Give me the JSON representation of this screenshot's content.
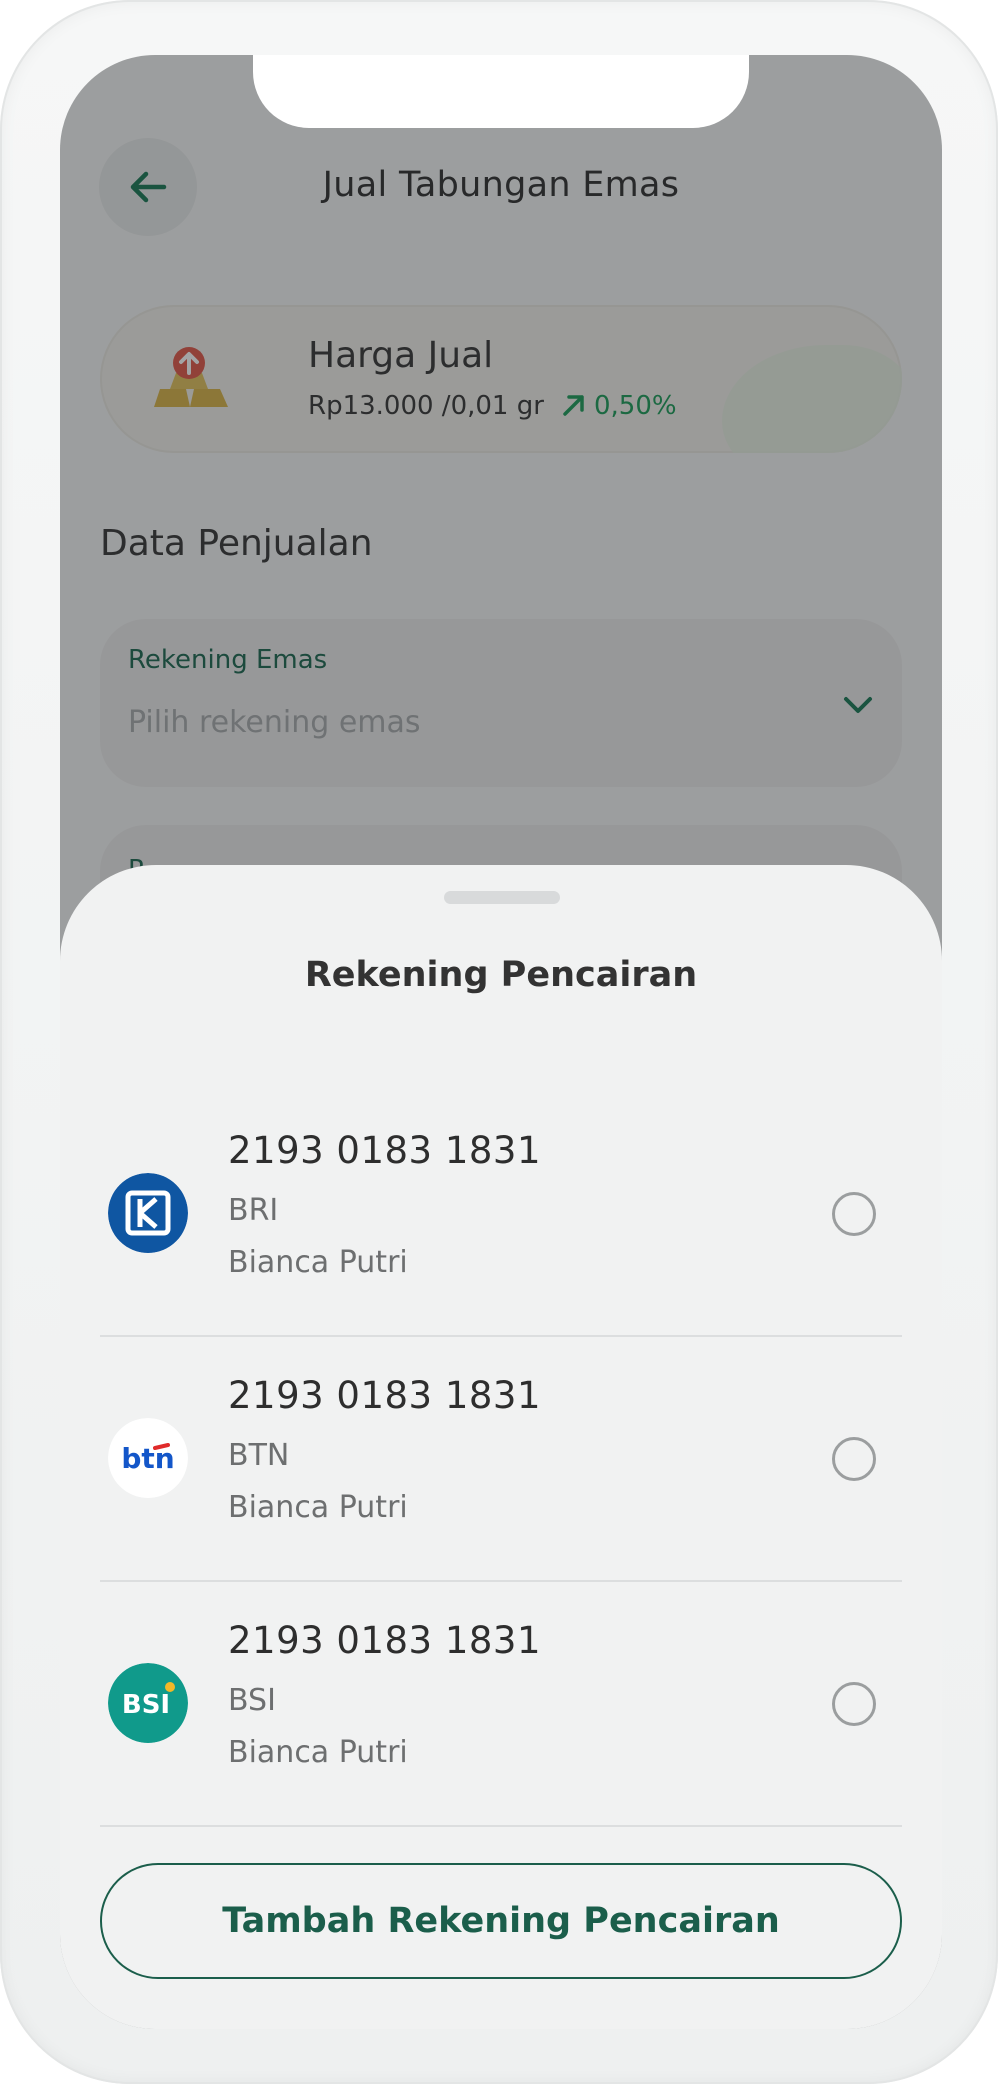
{
  "header": {
    "title": "Jual Tabungan Emas"
  },
  "price_card": {
    "label": "Harga Jual",
    "value": "Rp13.000 /0,01 gr",
    "change": "0,50%"
  },
  "section": {
    "title": "Data Penjualan"
  },
  "field_gold_account": {
    "label": "Rekening Emas",
    "placeholder": "Pilih rekening emas"
  },
  "field_second": {
    "label_partial": "R"
  },
  "sheet": {
    "title": "Rekening Pencairan",
    "accounts": [
      {
        "number": "2193 0183 1831",
        "bank": "BRI",
        "holder": "Bianca Putri",
        "logo_text": "",
        "logo_color": "#0f56a2"
      },
      {
        "number": "2193 0183 1831",
        "bank": "BTN",
        "holder": "Bianca Putri",
        "logo_text": "btn",
        "logo_color": "#1356c9"
      },
      {
        "number": "2193 0183 1831",
        "bank": "BSI",
        "holder": "Bianca Putri",
        "logo_text": "BSI",
        "logo_color": "#109a8b"
      }
    ],
    "add_button_label": "Tambah Rekening Pencairan"
  },
  "colors": {
    "accent_green": "#1b5e4b",
    "positive": "#1e9d5b"
  }
}
